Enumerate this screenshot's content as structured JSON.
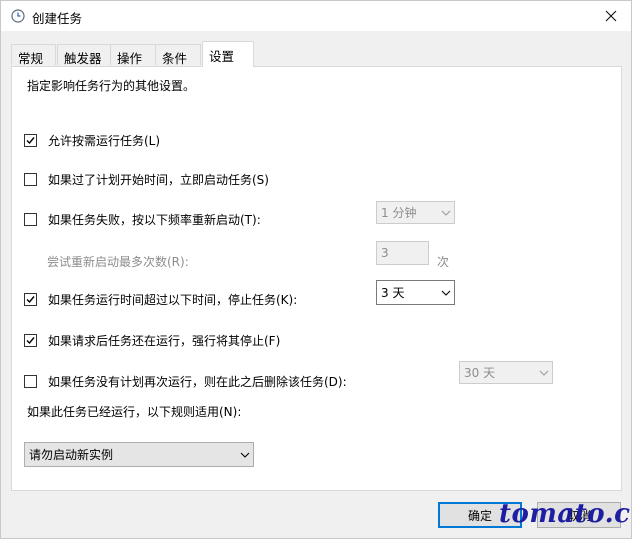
{
  "window": {
    "title": "创建任务"
  },
  "tabs": [
    {
      "label": "常规"
    },
    {
      "label": "触发器"
    },
    {
      "label": "操作"
    },
    {
      "label": "条件"
    },
    {
      "label": "设置"
    }
  ],
  "settings": {
    "description": "指定影响任务行为的其他设置。",
    "allow_on_demand": {
      "label": "允许按需运行任务(L)",
      "checked": true
    },
    "run_asap_after_missed": {
      "label": "如果过了计划开始时间，立即启动任务(S)",
      "checked": false
    },
    "restart_on_failure": {
      "label": "如果任务失败，按以下频率重新启动(T):",
      "checked": false,
      "interval": "1 分钟"
    },
    "restart_attempts": {
      "label": "尝试重新启动最多次数(R):",
      "value": "3",
      "unit": "次"
    },
    "stop_if_runs_longer": {
      "label": "如果任务运行时间超过以下时间，停止任务(K):",
      "checked": true,
      "duration": "3 天"
    },
    "force_stop": {
      "label": "如果请求后任务还在运行，强行将其停止(F)",
      "checked": true
    },
    "delete_if_not_scheduled": {
      "label": "如果任务没有计划再次运行，则在此之后删除该任务(D):",
      "checked": false,
      "after": "30 天"
    },
    "if_running_rule": {
      "label": "如果此任务已经运行，以下规则适用(N):",
      "value": "请勿启动新实例"
    }
  },
  "buttons": {
    "ok": "确定",
    "cancel": "取消"
  },
  "watermark": "tomato.cm",
  "colors": {
    "accent": "#0078d7",
    "watermark": "#1414a0"
  }
}
